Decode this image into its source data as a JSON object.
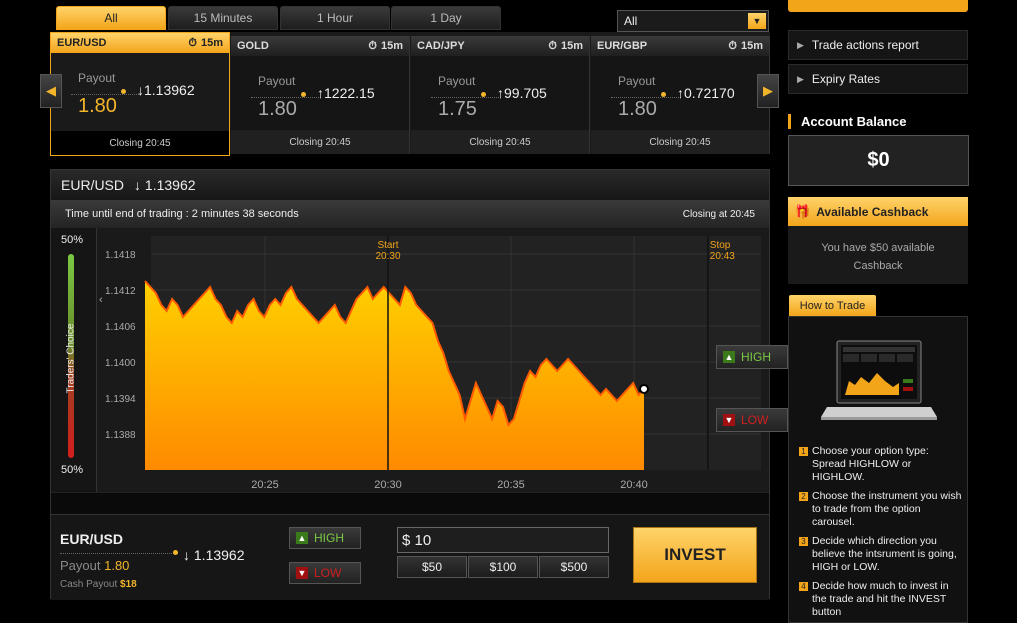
{
  "filters": {
    "tabs": [
      "All",
      "15 Minutes",
      "1 Hour",
      "1 Day"
    ],
    "select_value": "All"
  },
  "carousel": [
    {
      "symbol": "EUR/USD",
      "expiry": "15m",
      "payout_label": "Payout",
      "payout": "1.80",
      "direction": "↓",
      "rate": "1.13962",
      "closing": "Closing 20:45",
      "active": true
    },
    {
      "symbol": "GOLD",
      "expiry": "15m",
      "payout_label": "Payout",
      "payout": "1.80",
      "direction": "↑",
      "rate": "1222.15",
      "closing": "Closing 20:45",
      "active": false
    },
    {
      "symbol": "CAD/JPY",
      "expiry": "15m",
      "payout_label": "Payout",
      "payout": "1.75",
      "direction": "↑",
      "rate": "99.705",
      "closing": "Closing 20:45",
      "active": false
    },
    {
      "symbol": "EUR/GBP",
      "expiry": "15m",
      "payout_label": "Payout",
      "payout": "1.80",
      "direction": "↑",
      "rate": "0.72170",
      "closing": "Closing 20:45",
      "active": false
    }
  ],
  "panel": {
    "title_symbol": "EUR/USD",
    "title_direction": "↓",
    "title_rate": "1.13962",
    "time_until": "Time until end of trading : 2 minutes 38 seconds",
    "closing_at": "Closing at 20:45",
    "traders_choice": {
      "label": "Traders' Choice",
      "top": "50%",
      "bottom": "50%"
    },
    "high_label": "HIGH",
    "low_label": "LOW"
  },
  "chart_data": {
    "type": "area",
    "y_ticks": [
      "1.1418",
      "1.1412",
      "1.1406",
      "1.1400",
      "1.1394",
      "1.1388"
    ],
    "ylim": [
      1.1382,
      1.1421
    ],
    "x_ticks": [
      "20:25",
      "20:30",
      "20:35",
      "20:40"
    ],
    "markers": [
      {
        "label": "Start",
        "time": "20:30"
      },
      {
        "label": "Stop",
        "time": "20:43"
      }
    ],
    "series": [
      {
        "values": [
          1.14135,
          1.14125,
          1.14115,
          1.14095,
          1.14085,
          1.14105,
          1.14095,
          1.14075,
          1.14085,
          1.14095,
          1.14105,
          1.14115,
          1.14125,
          1.14105,
          1.14095,
          1.14075,
          1.14065,
          1.14085,
          1.14075,
          1.14095,
          1.14105,
          1.14085,
          1.14075,
          1.14095,
          1.14105,
          1.14095,
          1.14115,
          1.14125,
          1.14105,
          1.14095,
          1.14085,
          1.14075,
          1.14065,
          1.14075,
          1.14085,
          1.14095,
          1.14075,
          1.14065,
          1.14085,
          1.14105,
          1.14115,
          1.14125,
          1.14105,
          1.14115,
          1.14125,
          1.14115,
          1.14105,
          1.14095,
          1.14125,
          1.14115,
          1.14095,
          1.14085,
          1.14075,
          1.14065,
          1.14035,
          1.14015,
          1.13985,
          1.13965,
          1.13945,
          1.13905,
          1.13935,
          1.13965,
          1.13945,
          1.13925,
          1.13905,
          1.13935,
          1.13925,
          1.13895,
          1.13905,
          1.13935,
          1.13965,
          1.13985,
          1.13975,
          1.13995,
          1.14005,
          1.13995,
          1.13985,
          1.13995,
          1.14005,
          1.13995,
          1.13985,
          1.13975,
          1.13965,
          1.13955,
          1.13945,
          1.13955,
          1.13945,
          1.13935,
          1.13945,
          1.13955,
          1.13965,
          1.13945,
          1.13955
        ]
      }
    ]
  },
  "trade": {
    "symbol": "EUR/USD",
    "payout_label": "Payout",
    "payout": "1.80",
    "direction": "↓",
    "rate": "1.13962",
    "cash_label": "Cash Payout",
    "cash_value": "$18",
    "high_label": "HIGH",
    "low_label": "LOW",
    "amount": "$ 10",
    "presets": [
      "$50",
      "$100",
      "$500"
    ],
    "invest_label": "INVEST"
  },
  "sidebar": {
    "links": [
      "Trade actions report",
      "Expiry Rates"
    ],
    "account_title": "Account Balance",
    "balance": "$0",
    "cashback_title": "Available Cashback",
    "cashback_text": "You have $50 available Cashback",
    "how_to_tab": "How to Trade",
    "steps": [
      "Choose your option type: Spread HIGHLOW or HIGHLOW.",
      "Choose the instrument you wish to trade from the option carousel.",
      "Decide which direction you believe the intsrument is going, HIGH or LOW.",
      "Decide how much to invest in the trade and hit the INVEST button"
    ]
  },
  "colors": {
    "accent": "#f3a51a",
    "high": "#7ac943",
    "low": "#d21e1e"
  }
}
